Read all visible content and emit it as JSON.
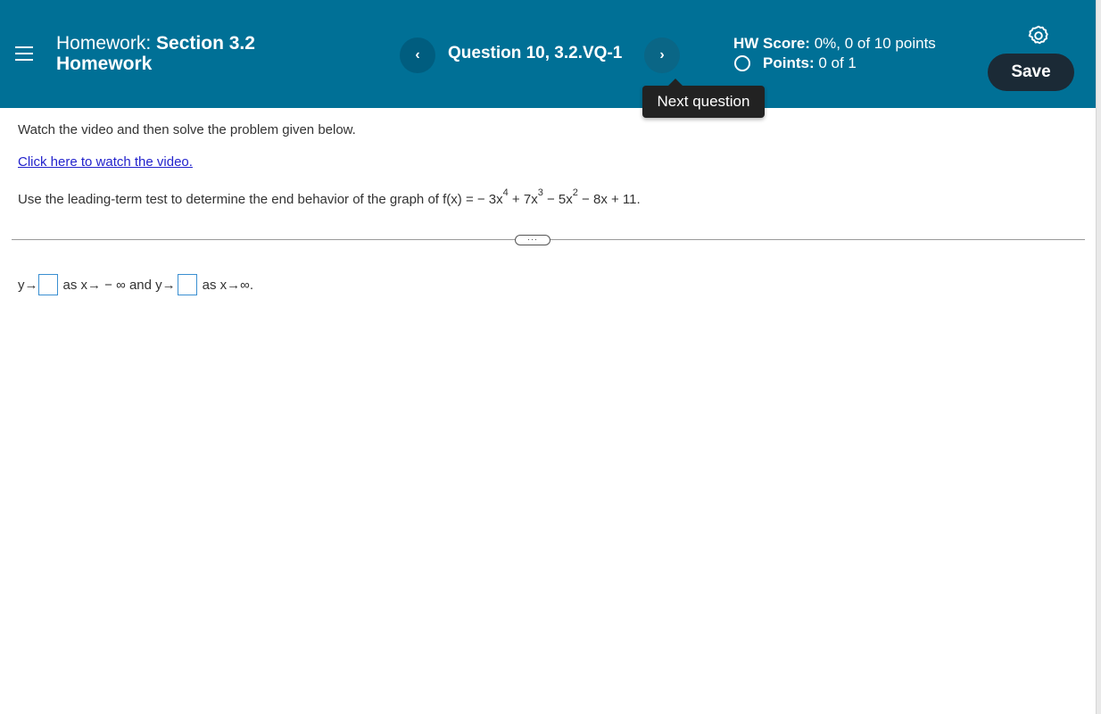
{
  "header": {
    "title_prefix": "Homework:",
    "title_bold_line1": "Section 3.2",
    "title_bold_line2": "Homework",
    "prev_icon": "‹",
    "next_icon": "›",
    "question_label": "Question 10, 3.2.VQ-1",
    "tooltip": "Next question",
    "hw_score_label": "HW Score:",
    "hw_score_value": "0%, 0 of 10 points",
    "points_label": "Points:",
    "points_value": "0 of 1",
    "save_label": "Save",
    "header_color": "#007096"
  },
  "content": {
    "instruction": "Watch the video and then solve the problem given below.",
    "video_link": "Click here to watch the video.",
    "problem_prefix": "Use the leading-term test to determine the end behavior of the graph of f(x) = − 3x",
    "exp1": "4",
    "term2": " + 7x",
    "exp2": "3",
    "term3": " − 5x",
    "exp3": "2",
    "problem_suffix": " − 8x + 11.",
    "expand_label": "···",
    "answer_y1": "y→",
    "answer_mid": "as x→ − ∞ and y→",
    "answer_end": "as x→∞."
  }
}
